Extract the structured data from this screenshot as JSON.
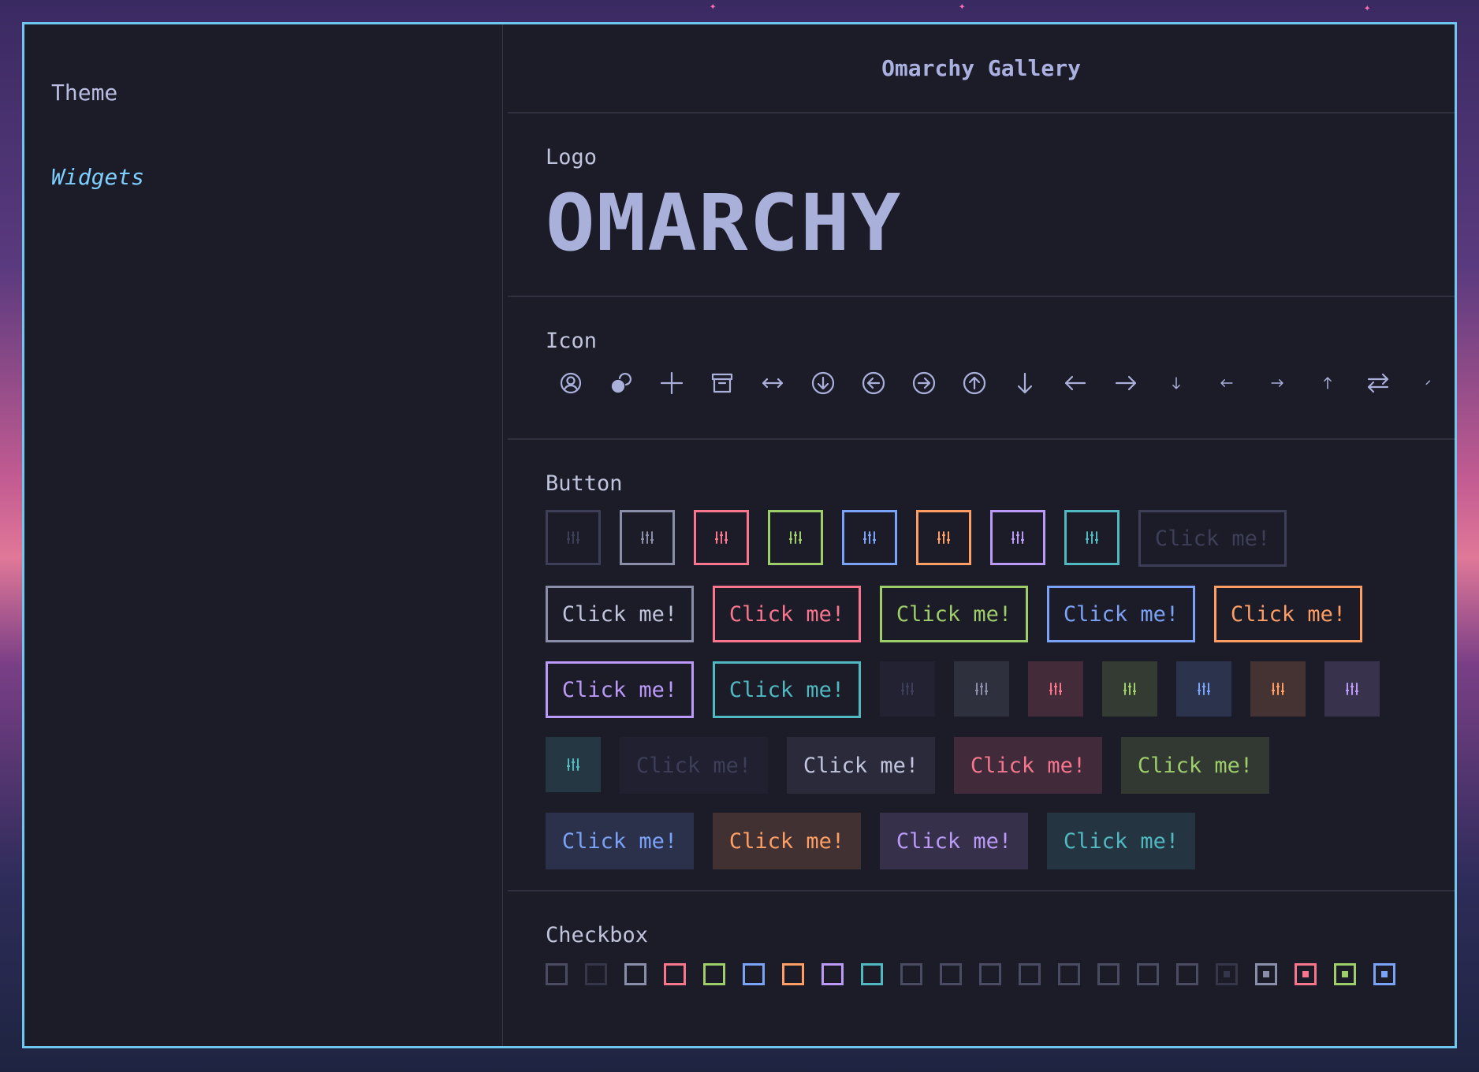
{
  "sidebar": {
    "items": [
      {
        "label": "Theme"
      },
      {
        "label": "Widgets"
      }
    ]
  },
  "title": "Omarchy Gallery",
  "logo": {
    "label": "Logo",
    "text": "OMARCHY"
  },
  "icons": {
    "label": "Icon",
    "items": [
      "user-circle-icon",
      "link-icon",
      "plus-icon",
      "archive-icon",
      "arrows-horizontal-icon",
      "arrow-down-circle-icon",
      "arrow-left-circle-icon",
      "arrow-right-circle-icon",
      "arrow-up-circle-icon",
      "arrow-down-icon",
      "arrow-left-icon",
      "arrow-right-icon",
      "arrow-down-small-icon",
      "arrow-left-small-icon",
      "arrow-right-small-icon",
      "arrow-up-small-icon",
      "swap-icon",
      "slash-icon"
    ]
  },
  "buttons": {
    "label": "Button",
    "text": "Click me!",
    "colors": {
      "muted": "#3d3f58",
      "default": "#8b8ea8",
      "red": "#f7768e",
      "green": "#9ece6a",
      "blue": "#7aa2f7",
      "orange": "#ff9e64",
      "purple": "#bb9af7",
      "cyan": "#4fb8c0"
    }
  },
  "checkbox": {
    "label": "Checkbox"
  }
}
